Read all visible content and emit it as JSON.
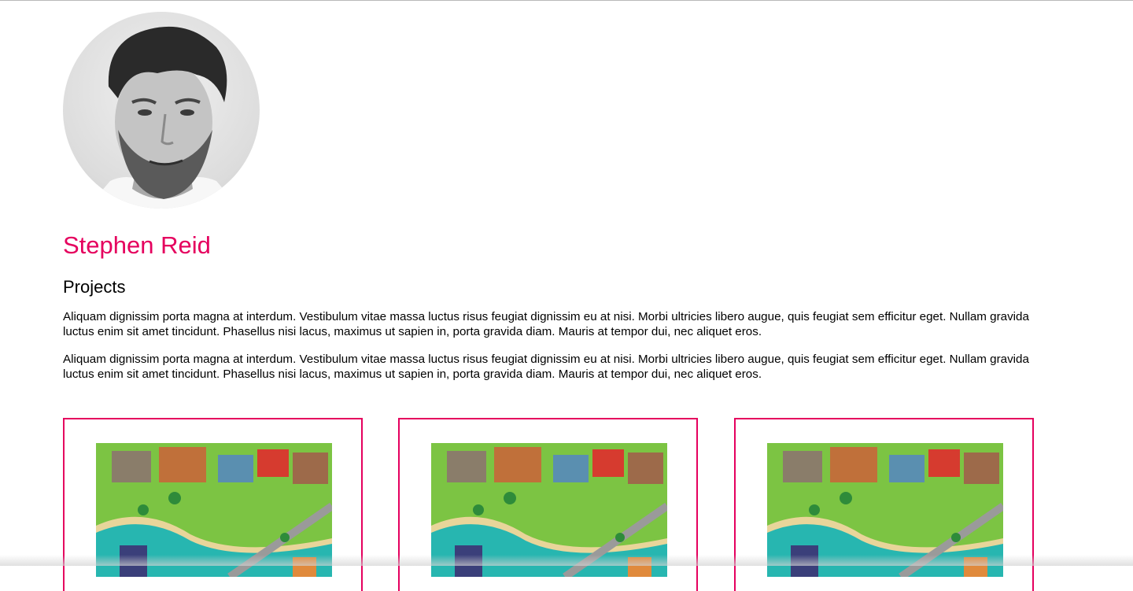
{
  "profile": {
    "name": "Stephen Reid",
    "avatar_alt": "Stephen Reid portrait"
  },
  "projects": {
    "heading": "Projects",
    "paragraphs": [
      "Aliquam dignissim porta magna at interdum. Vestibulum vitae massa luctus risus feugiat dignissim eu at nisi. Morbi ultricies libero augue, quis feugiat sem efficitur eget. Nullam gravida luctus enim sit amet tincidunt. Phasellus nisi lacus, maximus ut sapien in, porta gravida diam. Mauris at tempor dui, nec aliquet eros.",
      "Aliquam dignissim porta magna at interdum. Vestibulum vitae massa luctus risus feugiat dignissim eu at nisi. Morbi ultricies libero augue, quis feugiat sem efficitur eget. Nullam gravida luctus enim sit amet tincidunt. Phasellus nisi lacus, maximus ut sapien in, porta gravida diam. Mauris at tempor dui, nec aliquet eros."
    ],
    "cards": [
      {
        "image_alt": "Isometric town game screenshot"
      },
      {
        "image_alt": "Isometric town game screenshot"
      },
      {
        "image_alt": "Isometric town game screenshot"
      }
    ]
  },
  "colors": {
    "accent": "#e5005e",
    "text": "#000000",
    "background": "#ffffff"
  }
}
